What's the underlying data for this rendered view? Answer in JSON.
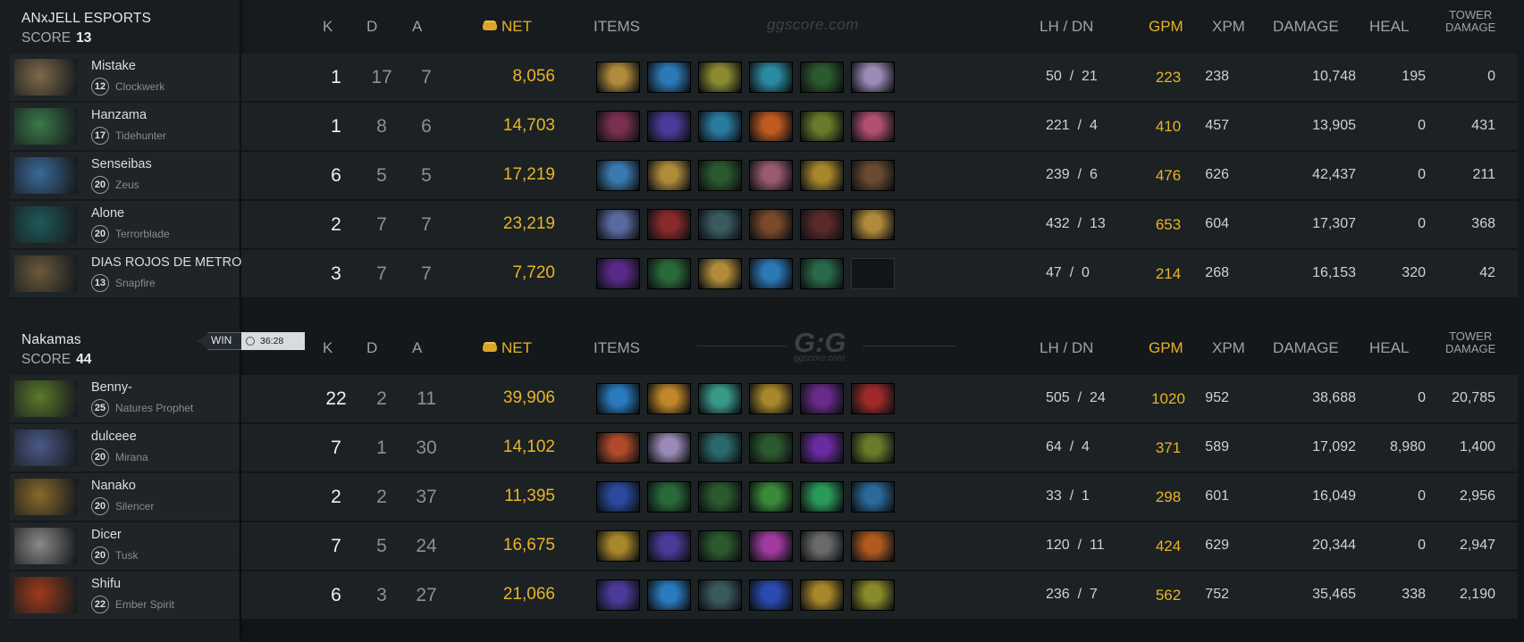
{
  "columns": {
    "k": "K",
    "d": "D",
    "a": "A",
    "net": "NET",
    "items": "ITEMS",
    "lhdn": "LH  /  DN",
    "gpm": "GPM",
    "xpm": "XPM",
    "damage": "DAMAGE",
    "heal": "HEAL",
    "tower1": "TOWER",
    "tower2": "DAMAGE"
  },
  "watermark": {
    "top": "ggscore.com",
    "logo": "G:G",
    "sub": "ggscore.com"
  },
  "teams": [
    {
      "name": "ANxJELL ESPORTS",
      "score_label": "SCORE",
      "score": "13",
      "players": [
        {
          "name": "Mistake",
          "level": "12",
          "hero": "Clockwerk",
          "k": "1",
          "d": "17",
          "a": "7",
          "net": "8,056",
          "lh": "50",
          "dn": "21",
          "gpm": "223",
          "xpm": "238",
          "damage": "10,748",
          "heal": "195",
          "tower": "0",
          "portrait": "#7d6a4a",
          "items": [
            {
              "icon": "bottle-icon",
              "color": "#b08b3a"
            },
            {
              "icon": "magic-wand-icon",
              "color": "#2c79b8"
            },
            {
              "icon": "tranquil-boots-icon",
              "color": "#8a8a30"
            },
            {
              "icon": "blink-dagger-icon",
              "color": "#2a8aa0"
            },
            {
              "icon": "branch-icon",
              "color": "#2c5a2f"
            },
            {
              "icon": "cloak-icon",
              "color": "#9a8ab5"
            }
          ]
        },
        {
          "name": "Hanzama",
          "level": "17",
          "hero": "Tidehunter",
          "k": "1",
          "d": "8",
          "a": "6",
          "net": "14,703",
          "lh": "221",
          "dn": "4",
          "gpm": "410",
          "xpm": "457",
          "damage": "13,905",
          "heal": "0",
          "tower": "431",
          "portrait": "#3a7a4a",
          "items": [
            {
              "icon": "ring-icon",
              "color": "#7a3050"
            },
            {
              "icon": "boots-icon",
              "color": "#4b3a9a"
            },
            {
              "icon": "blade-icon",
              "color": "#2a7aa0"
            },
            {
              "icon": "helm-icon",
              "color": "#c05a20"
            },
            {
              "icon": "staff-icon",
              "color": "#6a7a2a"
            },
            {
              "icon": "orb-icon",
              "color": "#b05070"
            }
          ]
        },
        {
          "name": "Senseibas",
          "level": "20",
          "hero": "Zeus",
          "k": "6",
          "d": "5",
          "a": "5",
          "net": "17,219",
          "lh": "239",
          "dn": "6",
          "gpm": "476",
          "xpm": "626",
          "damage": "42,437",
          "heal": "0",
          "tower": "211",
          "portrait": "#3a6a9a",
          "items": [
            {
              "icon": "scepter-icon",
              "color": "#3a7ab0"
            },
            {
              "icon": "bottle-icon",
              "color": "#b08b3a"
            },
            {
              "icon": "branch-icon",
              "color": "#2c5a2f"
            },
            {
              "icon": "octarine-icon",
              "color": "#9a5a70"
            },
            {
              "icon": "mask-icon",
              "color": "#a8862a"
            },
            {
              "icon": "travel-boots-icon",
              "color": "#6a4a30"
            }
          ]
        },
        {
          "name": "Alone",
          "level": "20",
          "hero": "Terrorblade",
          "k": "2",
          "d": "7",
          "a": "7",
          "net": "23,219",
          "lh": "432",
          "dn": "13",
          "gpm": "653",
          "xpm": "604",
          "damage": "17,307",
          "heal": "0",
          "tower": "368",
          "portrait": "#1d5a5a",
          "items": [
            {
              "icon": "axe-icon",
              "color": "#5a6aa0"
            },
            {
              "icon": "claw-icon",
              "color": "#8a2a2a"
            },
            {
              "icon": "skull-icon",
              "color": "#3a5a60"
            },
            {
              "icon": "boots-icon",
              "color": "#7a4a2a"
            },
            {
              "icon": "butterfly-icon",
              "color": "#5a2a2a"
            },
            {
              "icon": "bottle-icon",
              "color": "#b08b3a"
            }
          ]
        },
        {
          "name": "DIAS ROJOS DE METRO",
          "level": "13",
          "hero": "Snapfire",
          "k": "3",
          "d": "7",
          "a": "7",
          "net": "7,720",
          "lh": "47",
          "dn": "0",
          "gpm": "214",
          "xpm": "268",
          "damage": "16,153",
          "heal": "320",
          "tower": "42",
          "portrait": "#6a5a3a",
          "items": [
            {
              "icon": "potion-icon",
              "color": "#5a2a8a"
            },
            {
              "icon": "stick-icon",
              "color": "#2a6a3a"
            },
            {
              "icon": "bottle-icon",
              "color": "#b08b3a"
            },
            {
              "icon": "magic-wand-icon",
              "color": "#2c79b8"
            },
            {
              "icon": "staff-icon",
              "color": "#2a6a4a"
            },
            {
              "icon": "empty-slot-icon",
              "color": ""
            }
          ]
        }
      ]
    },
    {
      "name": "Nakamas",
      "score_label": "SCORE",
      "score": "44",
      "win": "WIN",
      "time": "36:28",
      "players": [
        {
          "name": "Benny-",
          "level": "25",
          "hero": "Natures Prophet",
          "k": "22",
          "d": "2",
          "a": "11",
          "net": "39,906",
          "lh": "505",
          "dn": "24",
          "gpm": "1020",
          "xpm": "952",
          "damage": "38,688",
          "heal": "0",
          "tower": "20,785",
          "portrait": "#5a7a2a",
          "items": [
            {
              "icon": "mjollnir-icon",
              "color": "#2a7ac0"
            },
            {
              "icon": "scepter-icon",
              "color": "#c0862a"
            },
            {
              "icon": "plate-icon",
              "color": "#3a9a8a"
            },
            {
              "icon": "mask-icon",
              "color": "#a8862a"
            },
            {
              "icon": "blade-icon",
              "color": "#6a2a8a"
            },
            {
              "icon": "axe-icon",
              "color": "#a02a2a"
            }
          ]
        },
        {
          "name": "dulceee",
          "level": "20",
          "hero": "Mirana",
          "k": "7",
          "d": "1",
          "a": "30",
          "net": "14,102",
          "lh": "64",
          "dn": "4",
          "gpm": "371",
          "xpm": "589",
          "damage": "17,092",
          "heal": "8,980",
          "tower": "1,400",
          "portrait": "#4a5a8a",
          "items": [
            {
              "icon": "armor-icon",
              "color": "#b04a2a"
            },
            {
              "icon": "cloak-icon",
              "color": "#9a8ab5"
            },
            {
              "icon": "boots-icon",
              "color": "#2a6a6a"
            },
            {
              "icon": "branch-icon",
              "color": "#2c5a2f"
            },
            {
              "icon": "potion-icon",
              "color": "#6a2aa0"
            },
            {
              "icon": "staff-icon",
              "color": "#6a7a2a"
            }
          ]
        },
        {
          "name": "Nanako",
          "level": "20",
          "hero": "Silencer",
          "k": "2",
          "d": "2",
          "a": "37",
          "net": "11,395",
          "lh": "33",
          "dn": "1",
          "gpm": "298",
          "xpm": "601",
          "damage": "16,049",
          "heal": "0",
          "tower": "2,956",
          "portrait": "#8a6a2a",
          "items": [
            {
              "icon": "cape-icon",
              "color": "#2a4aa0"
            },
            {
              "icon": "staff-icon",
              "color": "#2a6a3a"
            },
            {
              "icon": "branch-icon",
              "color": "#2c5a2f"
            },
            {
              "icon": "gem-icon",
              "color": "#3a8a3a"
            },
            {
              "icon": "swirl-icon",
              "color": "#2a9a5a"
            },
            {
              "icon": "skull-icon",
              "color": "#2a6a9a"
            }
          ]
        },
        {
          "name": "Dicer",
          "level": "20",
          "hero": "Tusk",
          "k": "7",
          "d": "5",
          "a": "24",
          "net": "16,675",
          "lh": "120",
          "dn": "11",
          "gpm": "424",
          "xpm": "629",
          "damage": "20,344",
          "heal": "0",
          "tower": "2,947",
          "portrait": "#8a8a8a",
          "items": [
            {
              "icon": "mask-icon",
              "color": "#a8862a"
            },
            {
              "icon": "boots-icon",
              "color": "#4b3a9a"
            },
            {
              "icon": "branch-icon",
              "color": "#2c5a2f"
            },
            {
              "icon": "orb-icon",
              "color": "#a03aa0"
            },
            {
              "icon": "ring-icon",
              "color": "#6a6a6a"
            },
            {
              "icon": "helm-icon",
              "color": "#b05a20"
            }
          ]
        },
        {
          "name": "Shifu",
          "level": "22",
          "hero": "Ember Spirit",
          "k": "6",
          "d": "3",
          "a": "27",
          "net": "21,066",
          "lh": "236",
          "dn": "7",
          "gpm": "562",
          "xpm": "752",
          "damage": "35,465",
          "heal": "338",
          "tower": "2,190",
          "portrait": "#a03a1a",
          "items": [
            {
              "icon": "boots-icon",
              "color": "#4b3a9a"
            },
            {
              "icon": "mjollnir-icon",
              "color": "#2a7ac0"
            },
            {
              "icon": "skull-icon",
              "color": "#3a5a60"
            },
            {
              "icon": "scepter-icon",
              "color": "#2a4ab0"
            },
            {
              "icon": "mask-icon",
              "color": "#a8862a"
            },
            {
              "icon": "radiance-icon",
              "color": "#8a8a2a"
            }
          ]
        }
      ]
    }
  ]
}
